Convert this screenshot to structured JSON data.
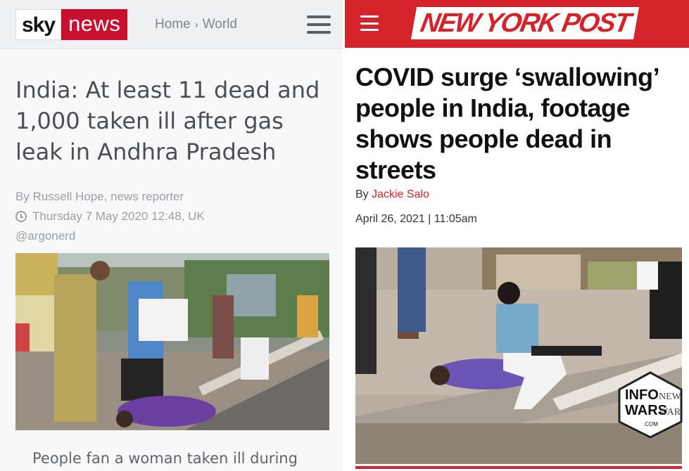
{
  "left": {
    "logo": {
      "sky": "sky",
      "news": "news"
    },
    "breadcrumb": {
      "home": "Home",
      "separator": "›",
      "section": "World"
    },
    "headline": "India: At least 11 dead and 1,000 taken ill after gas leak in Andhra Pradesh",
    "author": "By Russell Hope, news reporter",
    "date": "Thursday 7 May 2020 12:48, UK",
    "handle": "@argonerd",
    "caption": "People fan a woman taken ill during",
    "icons": {
      "menu": "hamburger-menu-icon",
      "clock": "clock-icon"
    },
    "colors": {
      "brand_red": "#c8102e",
      "header_bg": "#eef0f2"
    }
  },
  "right": {
    "logo": "NEW YORK POST",
    "headline": "COVID surge ‘swallowing’ people in India, footage shows people dead in streets",
    "byline_prefix": "By",
    "author": "Jackie Salo",
    "date": "April 26, 2021 | 11:05am",
    "icons": {
      "menu": "hamburger-menu-icon"
    },
    "colors": {
      "brand_red": "#d5232b"
    }
  },
  "watermark": {
    "line1": "INFO",
    "line2": "WARS",
    "line3": "NEW",
    "line4": "WAR",
    "small": ".COM"
  }
}
